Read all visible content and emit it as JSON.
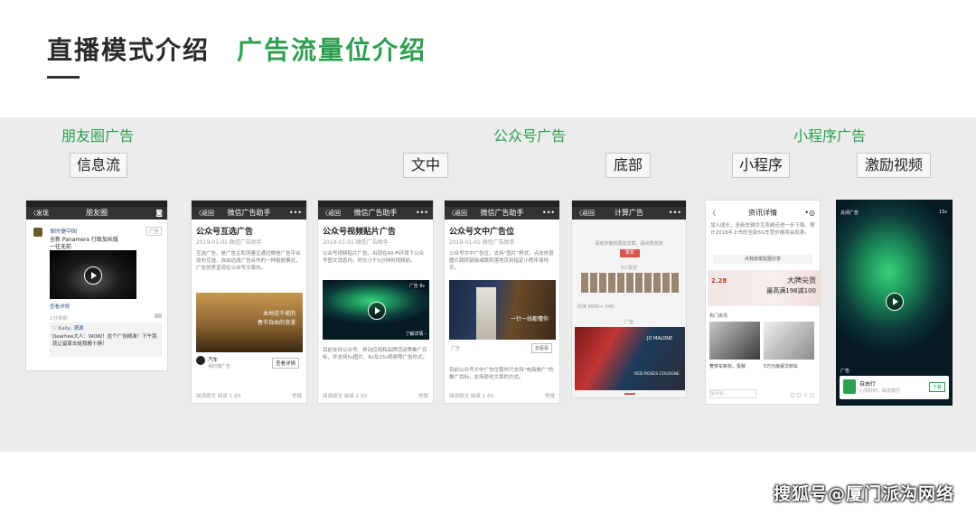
{
  "header": {
    "title_main": "直播模式介绍",
    "title_accent": "广告流量位介绍"
  },
  "categories": {
    "moments": "朋友圈广告",
    "official": "公众号广告",
    "miniprogram": "小程序广告"
  },
  "boxes": {
    "feed": "信息流",
    "in_article": "文中",
    "bottom": "底部",
    "mini": "小程序",
    "reward_video": "激励视频"
  },
  "phone1": {
    "nav_back": "〈发现",
    "nav_title": "朋友圈",
    "account": "保时捷中国",
    "ad_badge": "广告",
    "line1": "全新 Panamera 行政加长版",
    "line2": "一往无前",
    "more": "查看详情",
    "time": "1分钟前",
    "likes": "♡ Kally, 满满",
    "comment": "Dearhee大人：WOW！这个广告精准！下午我就让留家去给我搬十辆！"
  },
  "phone2": {
    "nav_back": "〈返回",
    "nav_title": "微信广告助手",
    "title": "公众号互选广告",
    "meta": "2019-01-01  微信广告助手",
    "text": "互选广告，是广告主和流量主通过微信广告平台双向互选、自由达成广告合作的一种投放模式，广告创意呈现在公众号文章内。",
    "img_caption1": "本地花千佬的",
    "img_caption2": "春节自由的浪漫",
    "brand": "汽车",
    "brand_sub": "保时捷广告",
    "cta": "查看详情",
    "foot": "阅读原文  阅读 1  ♁0",
    "foot_right": "举报"
  },
  "phone3": {
    "nav_back": "〈返回",
    "nav_title": "微信广告助手",
    "title": "公众号视频贴片广告",
    "meta": "2019-01-01  微信广告助手",
    "text": "公众号视频贴片广告，出现在Wi-Fi环境下公众号图文消息内，时长小于5分钟的视频前。",
    "ad_badge": "广告 8s",
    "ad_link": "了解详情 ›",
    "text2": "目前支持公众号、移动应用和品牌活动等推广目标，并支持5s图片、6s及15s视频等广告形式。",
    "foot": "阅读原文  阅读 1  ♁0",
    "foot_right": "举报"
  },
  "phone4": {
    "nav_back": "〈返回",
    "nav_title": "微信广告助手",
    "title": "公众号文中广告位",
    "meta": "2019-01-01  微信广告助手",
    "text": "公众号文中广告位，支持“图片”样式，点击外层图片跳转链接或跳转落地页到指定小程序落地页。",
    "img_text": "一针一线都懂你",
    "ad_label": "广告",
    "ad_btn": "去看看",
    "text2": "目前公众号文中广告位暂时只支持“电商推广”的推广目标，支持原创文章的方式。",
    "foot": "阅读原文  阅读 1  ♁0",
    "foot_right": "举报"
  },
  "phone5": {
    "nav_back": "〈返回",
    "nav_title": "计算广告",
    "prompt": "喜欢作者的原创文章，请点赞支持",
    "reward_btn": "赞赏",
    "count": "9人赞赏",
    "read": "阅读 9999+  ♁48",
    "ad_label": "广告",
    "brand": "JO MALONE",
    "product": "RED ROSES COLOGNE"
  },
  "phone6": {
    "nav_back": "〈",
    "nav_title": "资讯详情",
    "text": "加入成长，全新车辆交互系统还进一步下降，预计2018年上市的全新5G车型价格将会现身。",
    "link": "点我去朋友圈分享",
    "promo1": "2.28",
    "promo2": "大牌尖货",
    "promo3": "最高满198减100",
    "section": "热门资讯",
    "caption1": "奢侈车新标，极致",
    "caption2": "5万元级豪华轿车",
    "footer_input": "写评论..."
  },
  "phone7": {
    "nav_back": "关闭广告",
    "nav_time": "15s",
    "ad_label": "广告",
    "app_name": "自由行",
    "app_sub": "心情好时，就去旅行",
    "app_btn": "下载"
  },
  "watermark": "搜狐号@厦门派沟网络"
}
